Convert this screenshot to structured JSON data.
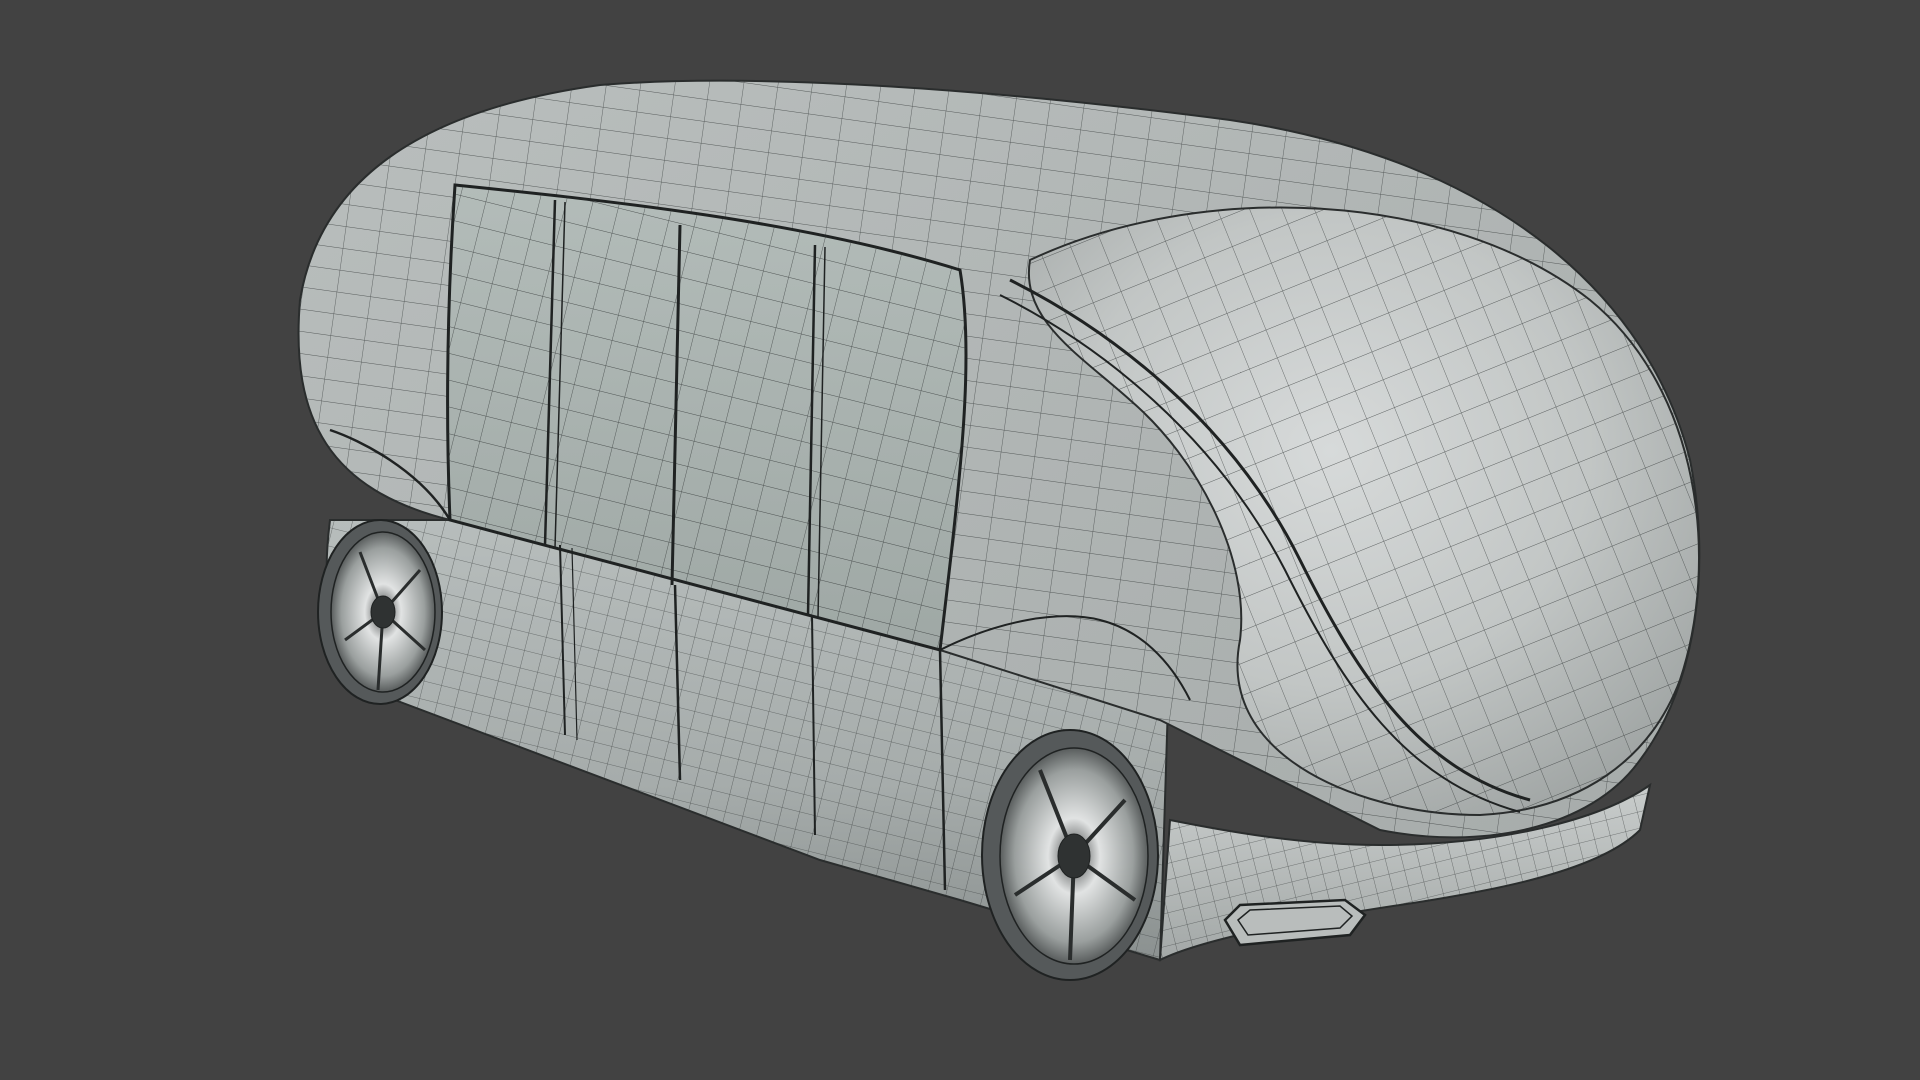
{
  "scene": {
    "subject": "wireframe-shuttle-vehicle",
    "view": "3d-viewport",
    "colors": {
      "background": "#424242",
      "body_light": "#c9cccb",
      "body_mid": "#a9aeae",
      "body_dark": "#7c8181",
      "window_tint": "#aab4b1",
      "wire": "#2a2d2d",
      "tire": "#5a5d5d",
      "rim": "#d8dada"
    },
    "meshes": [
      "body",
      "roof",
      "window-panel",
      "front-cap",
      "front-bumper",
      "front-light",
      "front-wheel",
      "rear-wheel"
    ]
  }
}
